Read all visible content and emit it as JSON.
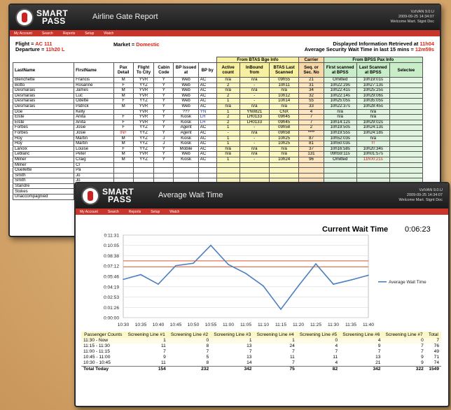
{
  "brand": {
    "line1": "SMART",
    "line2": "PASS"
  },
  "gate": {
    "title": "Airline Gate Report",
    "user_line1": "VzIVAN 9.0.U",
    "user_line2": "2009-09-25 14:34:07",
    "user_line3": "Welcome Mart. Stgnt Doc",
    "menu": [
      "My Account",
      "Search",
      "Reports",
      "Setup",
      "Watch"
    ],
    "flight_label": "Flight = ",
    "flight": "AC 111",
    "departure_label": "Departure = ",
    "departure": "11h20 L",
    "market_label": "Market = ",
    "market": "Domestic",
    "retrieved_label": "Displayed Information Retrieved at ",
    "retrieved": "11h04",
    "wait_label": "Average Security Wait Time in last 15 mins = ",
    "wait": "12m59s",
    "group_btas": "From BTAS Bge Info",
    "group_carrier": "Carrier",
    "group_bpss": "From BPSS Pax Info",
    "columns": [
      "LastName",
      "FirstName",
      "Pax Detail",
      "Flight To City",
      "Cabin Code",
      "BP Issued at",
      "BP by",
      "Active count",
      "InBound from",
      "BTAS Last Scanned",
      "Seq. or Sec. No",
      "First scanned at BPSS",
      "Last Scanned at BPSS",
      "Selectee"
    ],
    "rows": [
      [
        "Blenchette",
        "Francis",
        "M",
        "YVR",
        "Y",
        "Web",
        "AC",
        "n/a",
        "n/a",
        "09h55",
        "21",
        "Omitted",
        "10h19:01s",
        ""
      ],
      [
        "Botto",
        "Rosanne",
        "F",
        "YYZ",
        "Y",
        "Web",
        "AC",
        "2",
        "-",
        "10h11",
        "31",
        "10h22:29s",
        "10h27:13s",
        ""
      ],
      [
        "Desmarais",
        "James",
        "M",
        "YVR",
        "Y",
        "Web",
        "AC",
        "n/a",
        "n/a",
        "n/a",
        "34",
        "10h22:41s",
        "10h25:25s",
        ""
      ],
      [
        "Desmarais",
        "Luc",
        "M",
        "YVR",
        "Y",
        "Web",
        "AC",
        "2",
        "-",
        "10h12",
        "32",
        "10h22:14s",
        "10h29:06s",
        ""
      ],
      [
        "Desmarais",
        "Odette",
        "F",
        "YYZ",
        "Y",
        "Web",
        "AC",
        "1",
        "-",
        "10h14",
        "55",
        "10h25:05s",
        "10h35:05s",
        ""
      ],
      [
        "Desmarais",
        "Patrick",
        "M",
        "YVR",
        "Y",
        "Web",
        "AC",
        "n/a",
        "n/a",
        "n/a",
        "33",
        "10h22:37s",
        "10h28:45s",
        ""
      ],
      [
        "Doe",
        "Kelly",
        "",
        "YVR",
        "Y",
        "???",
        "YN",
        "1",
        "YN0821",
        "CNX",
        "4",
        "n/a",
        "n/a",
        ""
      ],
      [
        "Elste",
        "Anita",
        "F",
        "YVR",
        "Y",
        "Kiosk",
        "LH",
        "2",
        "LH0133",
        "09h45",
        "7",
        "n/a",
        "n/a",
        ""
      ],
      [
        "Elste",
        "Anita",
        "F",
        "YVR",
        "Y",
        "Kiosk",
        "LH",
        "2",
        "LH0133",
        "09h45",
        "7",
        "10h14:12s",
        "10h29:02s",
        ""
      ],
      [
        "Forbes",
        "Josie",
        "F",
        "YYZ",
        "Y",
        "Agent",
        "AC",
        "1",
        "-",
        "09h58",
        "2",
        "10h19:50s",
        "10h24:13s",
        ""
      ],
      [
        "Forbes",
        "Josie",
        "INF",
        "YYZ",
        "Y",
        "Agent",
        "AC",
        "-",
        "n/a",
        "09h58",
        "****",
        "10h19:55s",
        "10h24:18s",
        ""
      ],
      [
        "Hoy",
        "Martin",
        "M",
        "YYZ",
        "J",
        "Kiosk",
        "AC",
        "1",
        "-",
        "10h25",
        "87",
        "10h52:03s",
        "n/a",
        ""
      ],
      [
        "Hoy",
        "Martin",
        "M",
        "YYZ",
        "J",
        "Kiosk",
        "AC",
        "1",
        "-",
        "10h25",
        "81",
        "10h50:03s",
        "!!!",
        ""
      ],
      [
        "Lanoix",
        "Louise",
        "F",
        "YYZ",
        "Y",
        "Mobile",
        "AC",
        "n/a",
        "n/a",
        "n/a",
        "37",
        "10h16:58s",
        "10h20:34s",
        ""
      ],
      [
        "Leblanc",
        "Peter",
        "M",
        "YVR",
        "Y",
        "Web",
        "AC",
        "n/a",
        "n/a",
        "n/a",
        "131",
        "09h59:11s",
        "10h01:57s",
        ""
      ],
      [
        "Milner",
        "Craig",
        "M",
        "YYZ",
        "Y",
        "Kiosk",
        "AC",
        "1",
        "-",
        "10h24",
        "96",
        "Omitted",
        "11h00:21s",
        ""
      ],
      [
        "Milner",
        "Cr",
        "",
        "",
        "",
        "",
        "",
        "",
        "",
        "",
        "",
        "",
        "",
        ""
      ],
      [
        "Ouellette",
        "Pa",
        "",
        "",
        "",
        "",
        "",
        "",
        "",
        "",
        "",
        "",
        "",
        ""
      ],
      [
        "Smith",
        "Jo",
        "",
        "",
        "",
        "",
        "",
        "",
        "",
        "",
        "",
        "",
        "",
        ""
      ],
      [
        "Smith",
        "Jo",
        "",
        "",
        "",
        "",
        "",
        "",
        "",
        "",
        "",
        "",
        "",
        ""
      ],
      [
        "Standre",
        "Ma",
        "",
        "",
        "",
        "",
        "",
        "",
        "",
        "",
        "",
        "",
        "",
        ""
      ],
      [
        "Stokes",
        "Ma",
        "",
        "",
        "",
        "",
        "",
        "",
        "",
        "",
        "",
        "",
        "",
        ""
      ],
      [
        "Unaccompagnied",
        "Mo",
        "",
        "",
        "",
        "",
        "",
        "",
        "",
        "",
        "",
        "",
        "",
        ""
      ]
    ]
  },
  "wait": {
    "title": "Average Wait Time",
    "user_line1": "VzIVAN 9.0.U",
    "user_line2": "2009-09-25 14:34:07",
    "user_line3": "Welcome Mart. Stgnt Doc",
    "menu": [
      "My Account",
      "Search",
      "Reports",
      "Setup",
      "Watch"
    ],
    "current_label": "Current Wait Time",
    "current_value": "0:06:23",
    "table_headers": [
      "Passenger Counts",
      "Screening Line #1",
      "Screening Line #2",
      "Screening Line #3",
      "Screening Line #4",
      "Screening Line #5",
      "Screening Line #6",
      "Screening Line #7",
      "Total"
    ],
    "table_rows": [
      [
        "11:30 - Now",
        "1",
        "0",
        "1",
        "1",
        "0",
        "4",
        "0",
        "7"
      ],
      [
        "11:15 - 11:30",
        "11",
        "8",
        "13",
        "24",
        "4",
        "9",
        "7",
        "76"
      ],
      [
        "11:00 - 11:15",
        "7",
        "7",
        "7",
        "7",
        "7",
        "7",
        "7",
        "49"
      ],
      [
        "10:45 - 11:00",
        "9",
        "5",
        "13",
        "11",
        "11",
        "13",
        "9",
        "71"
      ],
      [
        "10:30 - 10:45",
        "11",
        "8",
        "14",
        "7",
        "4",
        "21",
        "9",
        "74"
      ]
    ],
    "total_row": [
      "Total Today",
      "154",
      "232",
      "342",
      "75",
      "82",
      "342",
      "322",
      "1549"
    ]
  },
  "chart_data": {
    "type": "line",
    "x": [
      "10:30",
      "10:35",
      "10:40",
      "10:45",
      "10:50",
      "10:55",
      "11:00",
      "11:05",
      "11:10",
      "11:15",
      "11:20",
      "11:25",
      "11:30",
      "11:35",
      "11:40"
    ],
    "series": [
      {
        "name": "Average Wait Time",
        "values": [
          "0:05:20",
          "0:06:00",
          "0:04:40",
          "0:07:15",
          "0:07:35",
          "0:10:05",
          "0:07:25",
          "0:06:10",
          "0:04:25",
          "0:01:10",
          "0:04:25",
          "0:07:30",
          "0:04:40",
          "0:05:15",
          "0:05:55"
        ]
      }
    ],
    "yticks": [
      "0:00:00",
      "0:01:26",
      "0:02:53",
      "0:04:19",
      "0:05:46",
      "0:07:12",
      "0:08:38",
      "0:10:05",
      "0:11:31"
    ],
    "ylim": [
      "0:00:00",
      "0:11:31"
    ],
    "grid": true,
    "legend": "right",
    "line_color": "#4a7fc1",
    "ref_line_color": "#d9552c"
  }
}
